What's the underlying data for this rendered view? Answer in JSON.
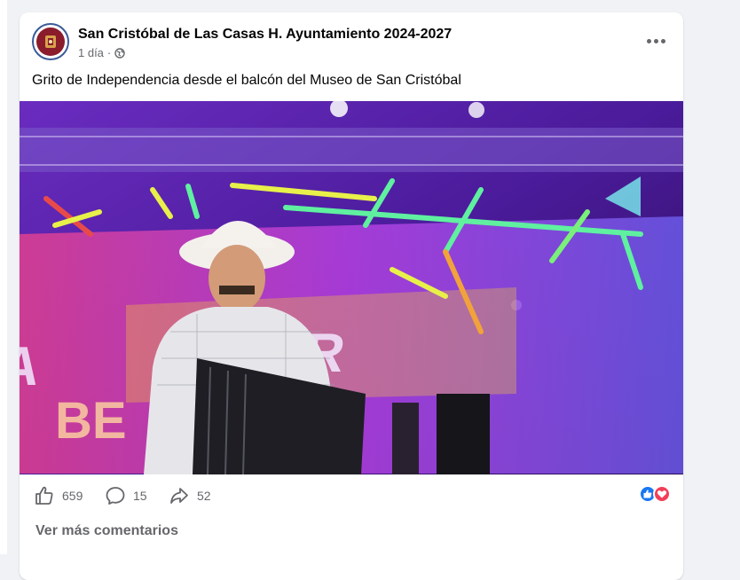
{
  "post": {
    "page_name": "San Cristóbal de Las Casas H. Ayuntamiento 2024-2027",
    "time_label": "1 día",
    "separator": "·",
    "privacy_icon": "globe-icon",
    "text": "Grito de Independencia desde el balcón del Museo de San Cristóbal",
    "media": {
      "type": "video-frame",
      "screen_text": "ANDER BE"
    }
  },
  "footer": {
    "like_count": "659",
    "comment_count": "15",
    "share_count": "52",
    "reaction_icons": [
      "like-reaction-icon",
      "love-reaction-icon"
    ],
    "more_comments_label": "Ver más comentarios"
  },
  "colors": {
    "page_bg": "#f0f2f5",
    "card_bg": "#ffffff",
    "text_primary": "#050505",
    "text_secondary": "#65676b",
    "like_blue": "#1877f2",
    "love_red": "#f33e58"
  }
}
